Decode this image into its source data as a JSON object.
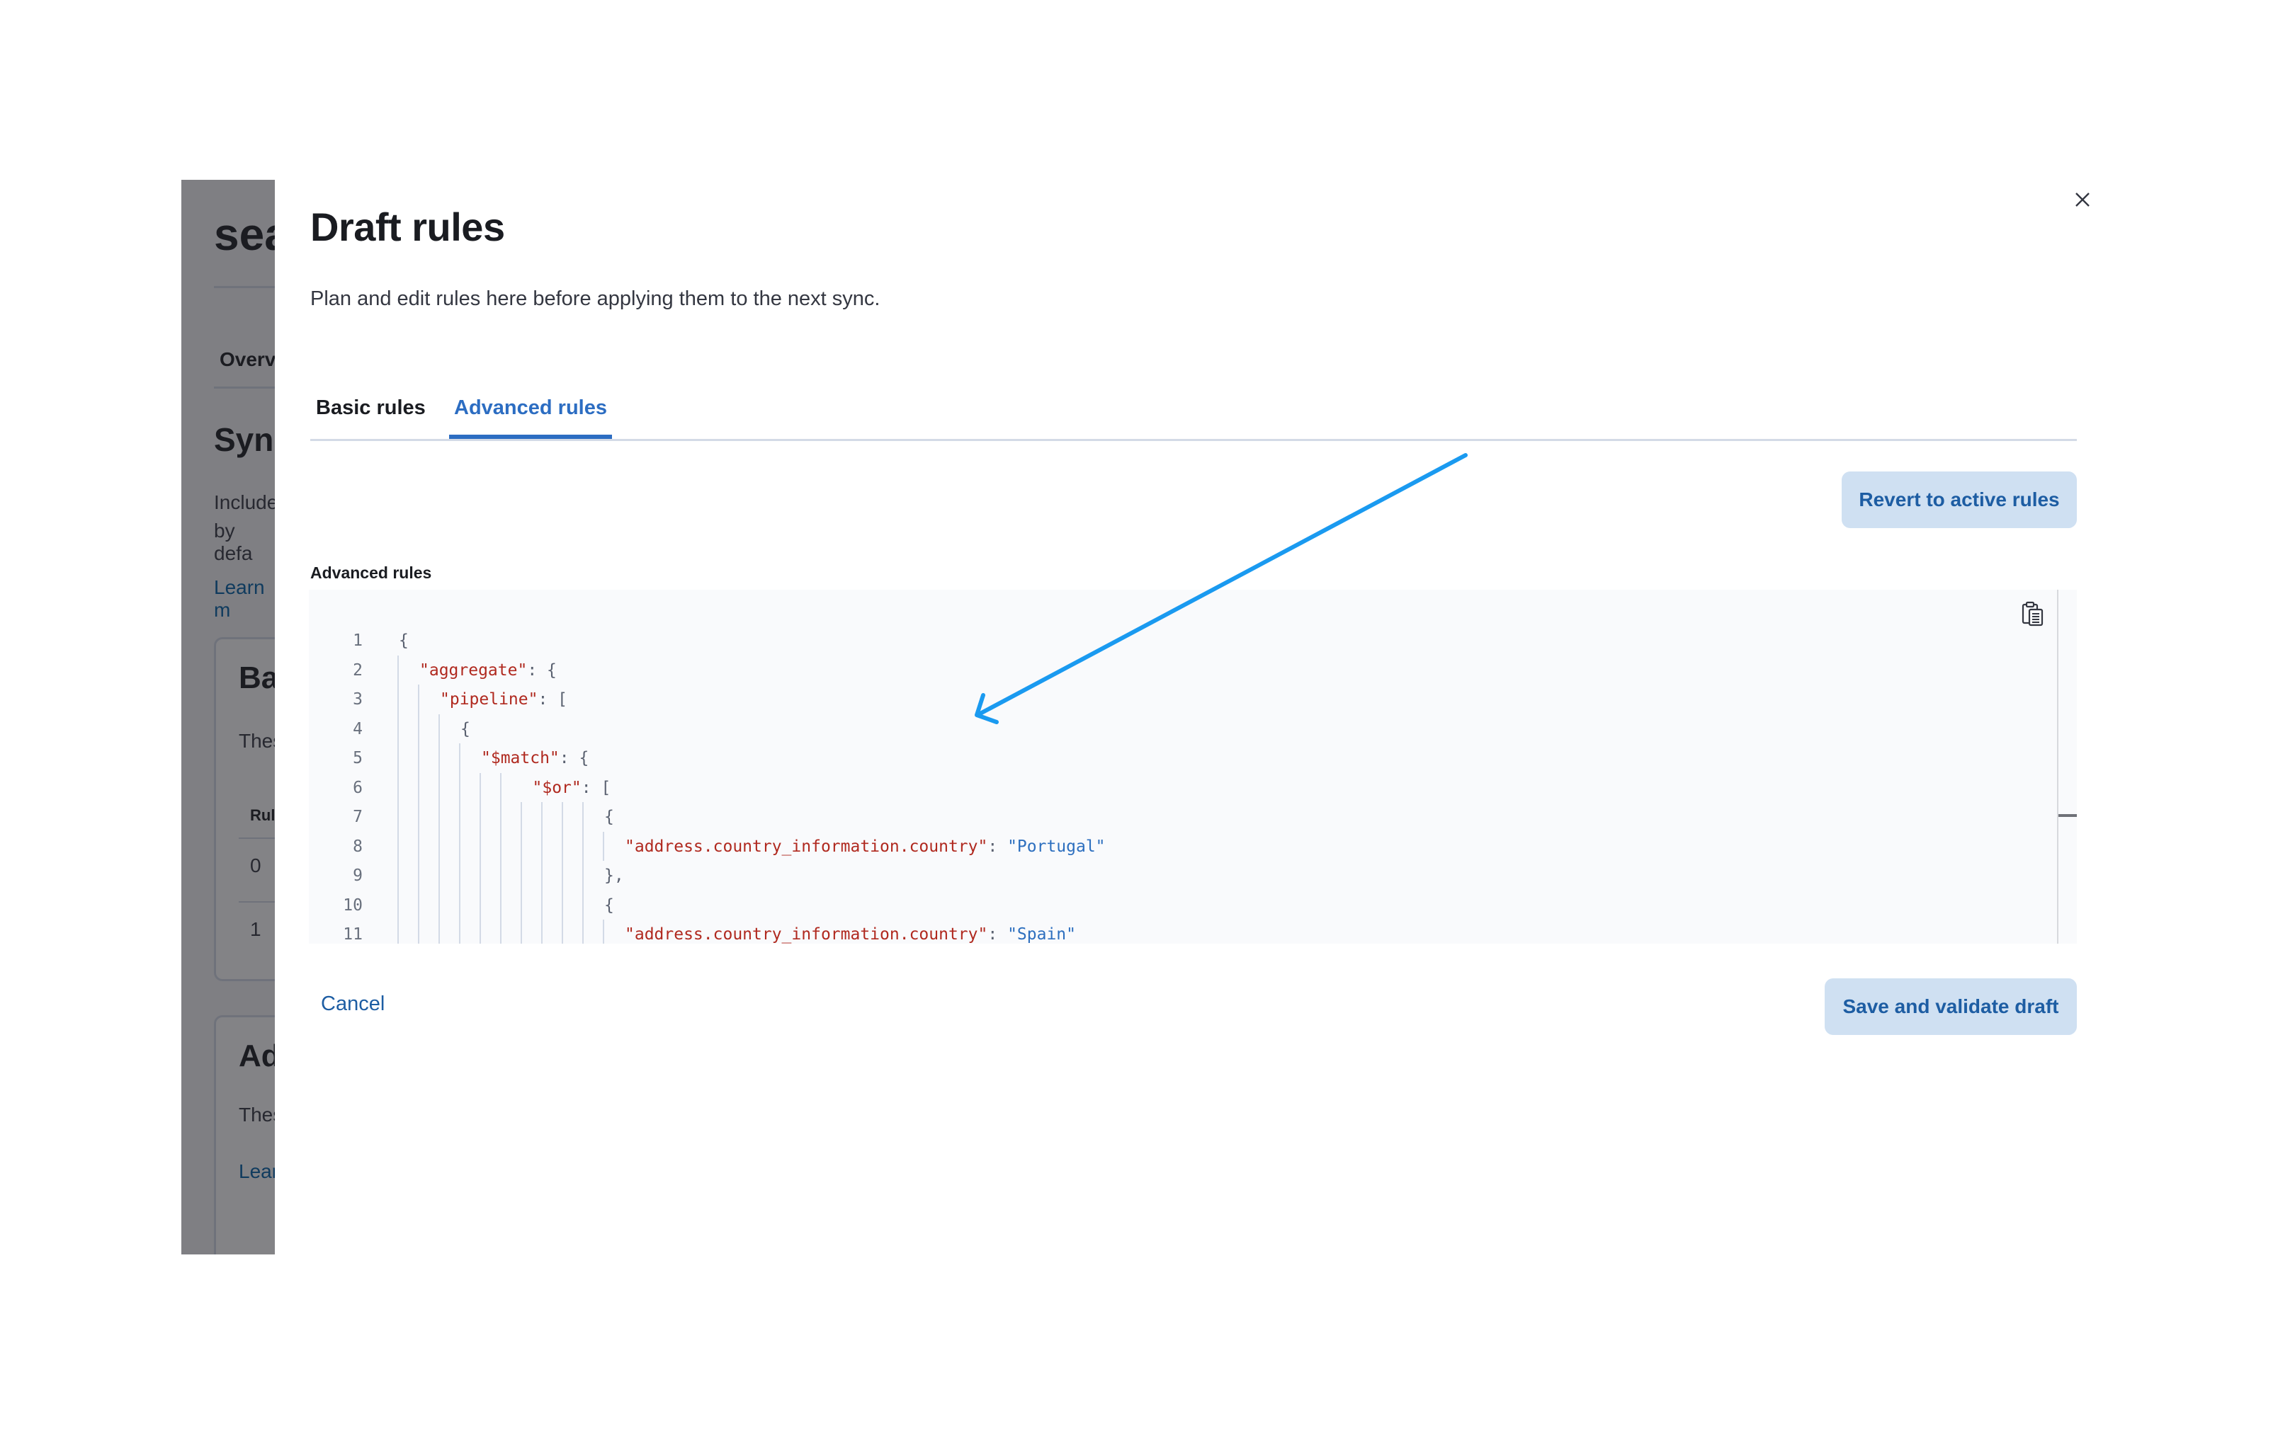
{
  "background_page": {
    "title_fragment": "sea",
    "tab_fragment": "Overv",
    "section_title_fragment": "Sync",
    "description_fragment_line1": "Include",
    "description_fragment_line2": "by defa",
    "link_fragment": "Learn m",
    "basic_card": {
      "title_fragment": "Ba",
      "text_fragment": "These",
      "column_header_fragment": "Rul",
      "rows": [
        "0",
        "1"
      ]
    },
    "advanced_card": {
      "title_fragment": "Ad",
      "text_fragment": "These",
      "link_fragment": "Lear"
    }
  },
  "flyout": {
    "title": "Draft rules",
    "description": "Plan and edit rules here before applying them to the next sync.",
    "close_icon": "close-icon",
    "tabs": [
      {
        "label": "Basic rules",
        "active": false
      },
      {
        "label": "Advanced rules",
        "active": true
      }
    ],
    "revert_button": "Revert to active rules",
    "field_label": "Advanced rules",
    "copy_icon": "clipboard-icon",
    "code_lines": [
      {
        "num": "1",
        "indent": 0,
        "tokens": [
          {
            "t": "p",
            "v": "{"
          }
        ]
      },
      {
        "num": "2",
        "indent": 2,
        "tokens": [
          {
            "t": "k",
            "v": "\"aggregate\""
          },
          {
            "t": "p",
            "v": ": {"
          }
        ]
      },
      {
        "num": "3",
        "indent": 4,
        "tokens": [
          {
            "t": "k",
            "v": "\"pipeline\""
          },
          {
            "t": "p",
            "v": ": ["
          }
        ]
      },
      {
        "num": "4",
        "indent": 6,
        "tokens": [
          {
            "t": "p",
            "v": "{"
          }
        ]
      },
      {
        "num": "5",
        "indent": 8,
        "tokens": [
          {
            "t": "k",
            "v": "\"$match\""
          },
          {
            "t": "p",
            "v": ": {"
          }
        ]
      },
      {
        "num": "6",
        "indent": 13,
        "tokens": [
          {
            "t": "k",
            "v": "\"$or\""
          },
          {
            "t": "p",
            "v": ": ["
          }
        ]
      },
      {
        "num": "7",
        "indent": 20,
        "tokens": [
          {
            "t": "p",
            "v": "{"
          }
        ]
      },
      {
        "num": "8",
        "indent": 22,
        "tokens": [
          {
            "t": "k",
            "v": "\"address.country_information.country\""
          },
          {
            "t": "p",
            "v": ": "
          },
          {
            "t": "s",
            "v": "\"Portugal\""
          }
        ]
      },
      {
        "num": "9",
        "indent": 20,
        "tokens": [
          {
            "t": "p",
            "v": "},"
          }
        ]
      },
      {
        "num": "10",
        "indent": 20,
        "tokens": [
          {
            "t": "p",
            "v": "{"
          }
        ]
      },
      {
        "num": "11",
        "indent": 22,
        "tokens": [
          {
            "t": "k",
            "v": "\"address.country_information.country\""
          },
          {
            "t": "p",
            "v": ": "
          },
          {
            "t": "s",
            "v": "\"Spain\""
          }
        ]
      }
    ],
    "cancel_label": "Cancel",
    "save_button": "Save and validate draft"
  },
  "annotation": {
    "type": "arrow",
    "color": "#1a9af0",
    "points_to": "code-editor"
  },
  "colors": {
    "accent": "#2c6dc2",
    "button_bg": "#cfe0f2",
    "button_text": "#1d5da3",
    "json_key": "#b0291f",
    "json_string": "#2d6fbf"
  }
}
